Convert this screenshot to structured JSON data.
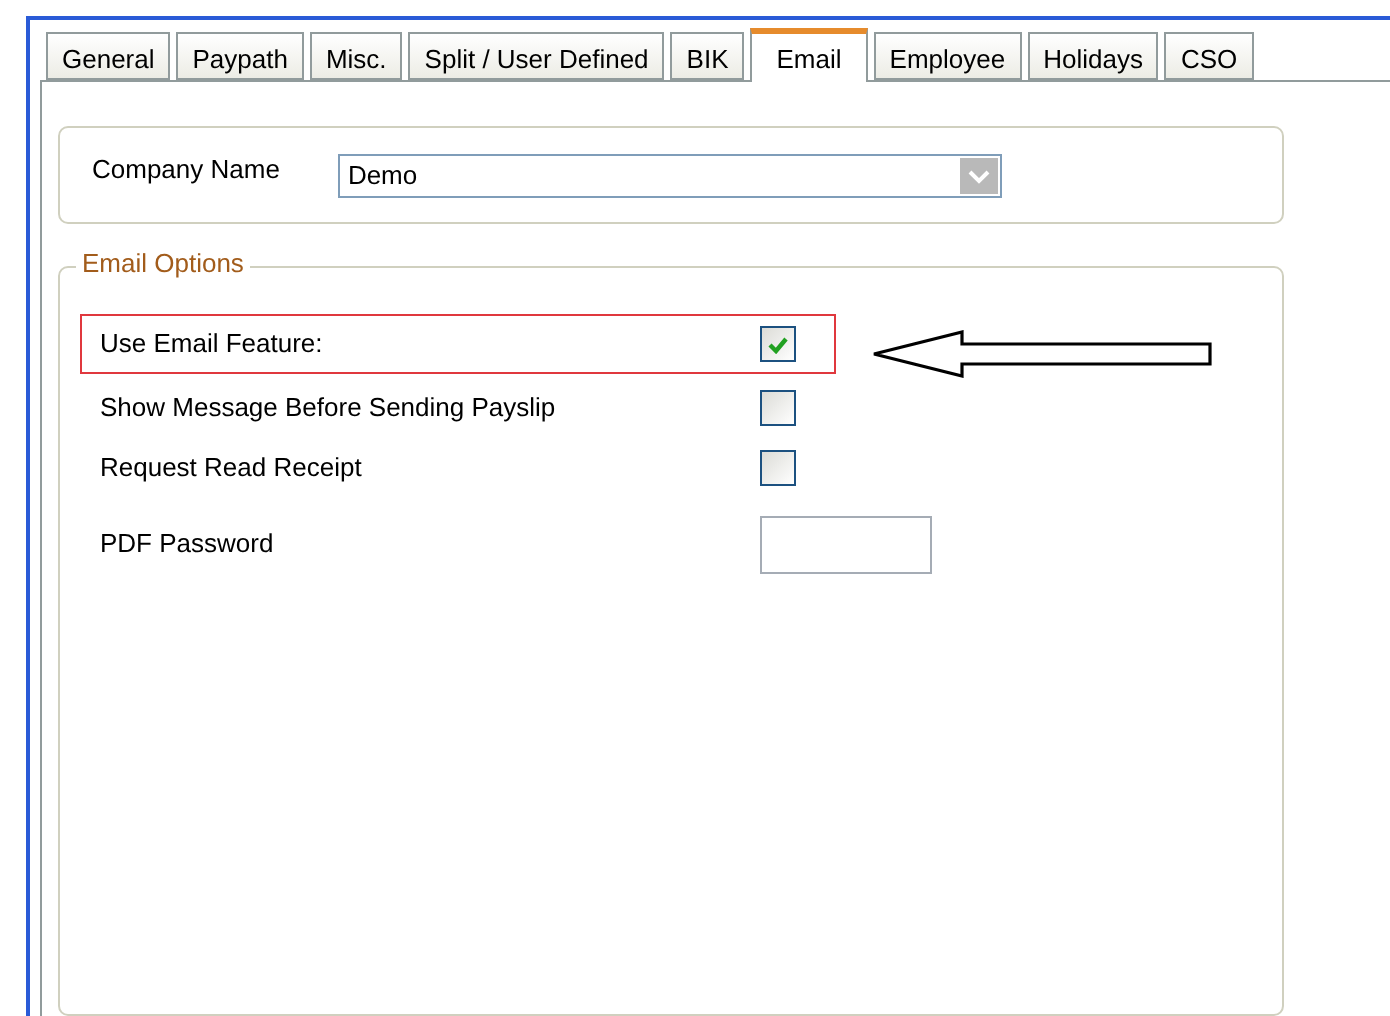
{
  "tabs": [
    {
      "label": "General",
      "selected": false
    },
    {
      "label": "Paypath",
      "selected": false
    },
    {
      "label": "Misc.",
      "selected": false
    },
    {
      "label": "Split / User Defined",
      "selected": false
    },
    {
      "label": "BIK",
      "selected": false
    },
    {
      "label": "Email",
      "selected": true
    },
    {
      "label": "Employee",
      "selected": false
    },
    {
      "label": "Holidays",
      "selected": false
    },
    {
      "label": "CSO",
      "selected": false
    }
  ],
  "company": {
    "label": "Company Name",
    "value": "Demo"
  },
  "email_options": {
    "title": "Email Options",
    "options": [
      {
        "kind": "checkbox",
        "label": "Use Email Feature:",
        "checked": true,
        "highlighted": true
      },
      {
        "kind": "checkbox",
        "label": "Show Message Before Sending Payslip",
        "checked": false,
        "highlighted": false
      },
      {
        "kind": "checkbox",
        "label": "Request Read Receipt",
        "checked": false,
        "highlighted": false
      },
      {
        "kind": "text",
        "label": "PDF Password",
        "highlighted": false
      }
    ]
  }
}
